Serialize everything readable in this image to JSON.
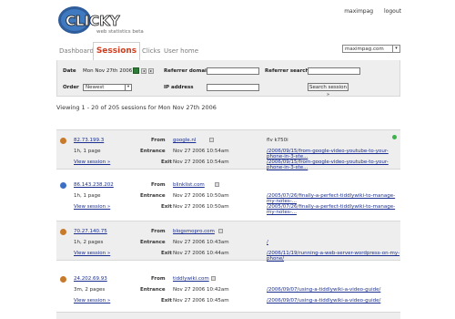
{
  "header": {
    "logo_text": "CLICKY",
    "tagline": "web statistics beta",
    "user": "maximpag",
    "logout": "logout"
  },
  "tabs": [
    {
      "label": "Dashboard"
    },
    {
      "label": "Sessions"
    },
    {
      "label": "Clicks"
    },
    {
      "label": "User home"
    }
  ],
  "site_select": {
    "value": "maximpag.com"
  },
  "filter": {
    "date_label": "Date",
    "date_value": "Mon Nov 27th 2006",
    "order_label": "Order",
    "order_value": "Newest",
    "referrer_domain_label": "Referrer domain",
    "referrer_search_label": "Referrer search",
    "ip_label": "IP address",
    "search_button": "Search session »"
  },
  "viewing_text": "Viewing 1 - 20 of 205 sessions for Mon Nov 27th 2006",
  "labels": {
    "from": "From",
    "entrance": "Entrance",
    "exit": "Exit",
    "view_session": "View session »"
  },
  "sessions": [
    {
      "ip": "82.73.199.3",
      "pages": "1h, 1 page",
      "from": "google.nl",
      "keyword": "flv k750i",
      "entrance_time": "Nov 27 2006 10:54am",
      "entrance_url": "/2006/09/15/from-google-video-youtube-to-your-phone-in-3-ste...",
      "exit_time": "Nov 27 2006 10:54am",
      "exit_url": "/2006/09/15/from-google-video-youtube-to-your-phone-in-3-ste...",
      "icon_color": "#c8792a"
    },
    {
      "ip": "86.143.238.202",
      "pages": "1h, 1 page",
      "from": "blinklist.com",
      "keyword": "",
      "entrance_time": "Nov 27 2006 10:50am",
      "entrance_url": "/2005/07/26/finally-a-perfect-tiddlywiki-to-manage-my-notes-...",
      "exit_time": "Nov 27 2006 10:50am",
      "exit_url": "/2005/07/26/finally-a-perfect-tiddlywiki-to-manage-my-notes-...",
      "icon_color": "#3d6fc4"
    },
    {
      "ip": "70.27.140.75",
      "pages": "1h, 2 pages",
      "from": "blogsmopro.com",
      "keyword": "",
      "entrance_time": "Nov 27 2006 10:43am",
      "entrance_url": "/",
      "exit_time": "Nov 27 2006 10:44am",
      "exit_url": "/2006/11/19/running-a-web-server-wordpress-on-my-phone/",
      "icon_color": "#c8792a"
    },
    {
      "ip": "24.202.69.93",
      "pages": "3m, 2 pages",
      "from": "tiddlywiki.com",
      "keyword": "",
      "entrance_time": "Nov 27 2006 10:42am",
      "entrance_url": "/2006/09/07/using-a-tiddlywiki-a-video-guide/",
      "exit_time": "Nov 27 2006 10:45am",
      "exit_url": "/2006/09/07/using-a-tiddlywiki-a-video-guide/",
      "icon_color": "#c8792a"
    }
  ],
  "colors": {
    "accent": "#d23c1c",
    "link": "#1a2f8f",
    "panel": "#eeeeee"
  }
}
